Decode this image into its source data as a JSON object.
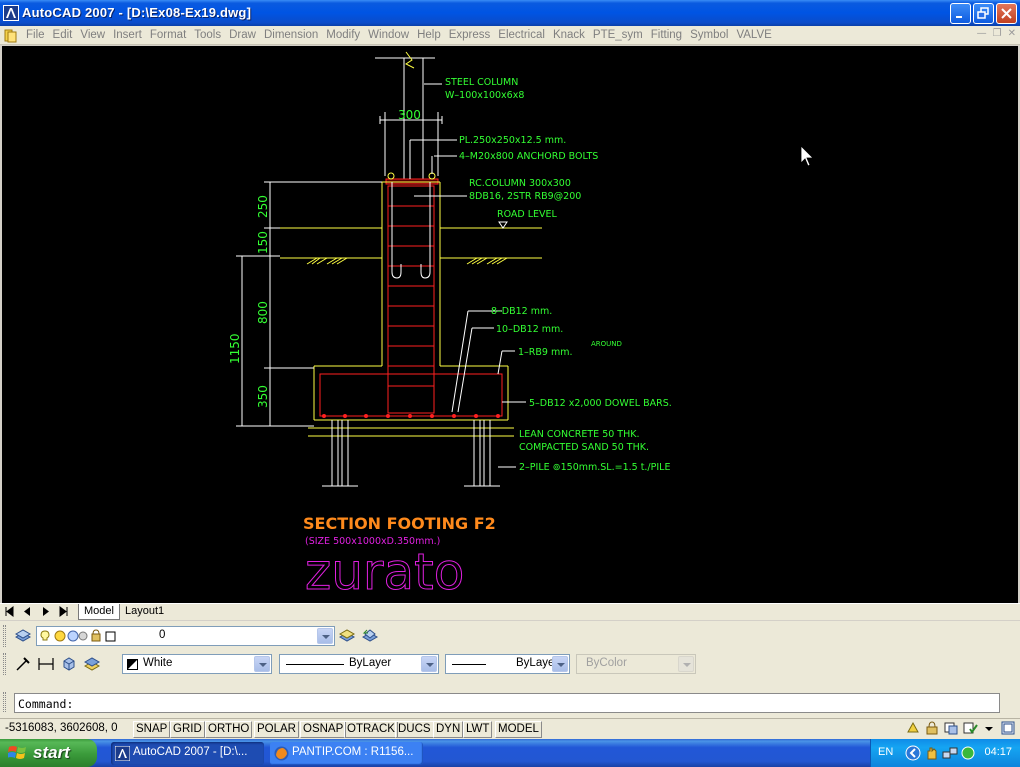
{
  "window": {
    "title": "AutoCAD 2007 - [D:\\Ex08-Ex19.dwg]"
  },
  "menu": [
    "File",
    "Edit",
    "View",
    "Insert",
    "Format",
    "Tools",
    "Draw",
    "Dimension",
    "Modify",
    "Window",
    "Help",
    "Express",
    "Electrical",
    "Knack",
    "PTE_sym",
    "Fitting",
    "Symbol",
    "VALVE"
  ],
  "drawing": {
    "labels": {
      "steel_column": "STEEL  COLUMN",
      "steel_column_size": "W–100x100x6x8",
      "dim_300": "300",
      "plate": "PL.250x250x12.5  mm.",
      "bolts": "4–M20x800  ANCHORD BOLTS",
      "rc_column": "RC.COLUMN  300x300",
      "rc_rebar": "8DB16, 2STR  RB9@200",
      "road_level": "ROAD  LEVEL",
      "dim_250": "250",
      "dim_150": "150",
      "dim_800": "800",
      "dim_1150": "1150",
      "dim_350": "350",
      "rebar_8db12": "8–DB12  mm.",
      "rebar_10db12": "10–DB12  mm.",
      "rebar_rb9": "1–RB9  mm.",
      "around": "AROUND",
      "dowel": "5–DB12  x2,000  DOWEL BARS.",
      "lean": "LEAN  CONCRETE  50  THK.",
      "sand": "COMPACTED  SAND  50  THK.",
      "pile": "2–PILE  ⊚150mm.SL.=1.5  t./PILE",
      "section_title": "SECTION FOOTING  F2",
      "section_size": "(SIZE  500x1000xD.350mm.)",
      "signature": "zurato"
    }
  },
  "tabs": {
    "model": "Model",
    "layout1": "Layout1"
  },
  "layers_toolbar": {
    "current_layer": "0"
  },
  "properties_toolbar": {
    "color": "White",
    "linetype": "ByLayer",
    "lineweight": "ByLayer",
    "plotstyle": "ByColor"
  },
  "command": {
    "prompt": "Command:"
  },
  "status": {
    "coordinates": "-5316083, 3602608, 0",
    "buttons": [
      "SNAP",
      "GRID",
      "ORTHO",
      "POLAR",
      "OSNAP",
      "OTRACK",
      "DUCS",
      "DYN",
      "LWT",
      "MODEL"
    ]
  },
  "taskbar": {
    "start_label": "start",
    "items": [
      {
        "label": "AutoCAD 2007 - [D:\\...",
        "active": true
      },
      {
        "label": "PANTIP.COM : R1156...",
        "active": false
      }
    ],
    "language": "EN",
    "clock": "04:17"
  },
  "colors": {
    "cad_green": "#33ff33",
    "cad_red": "#ff2020",
    "cad_yellow": "#ffff44",
    "cad_white": "#ffffff",
    "cad_orange": "#ff8a1c",
    "cad_magenta": "#e020e0"
  }
}
